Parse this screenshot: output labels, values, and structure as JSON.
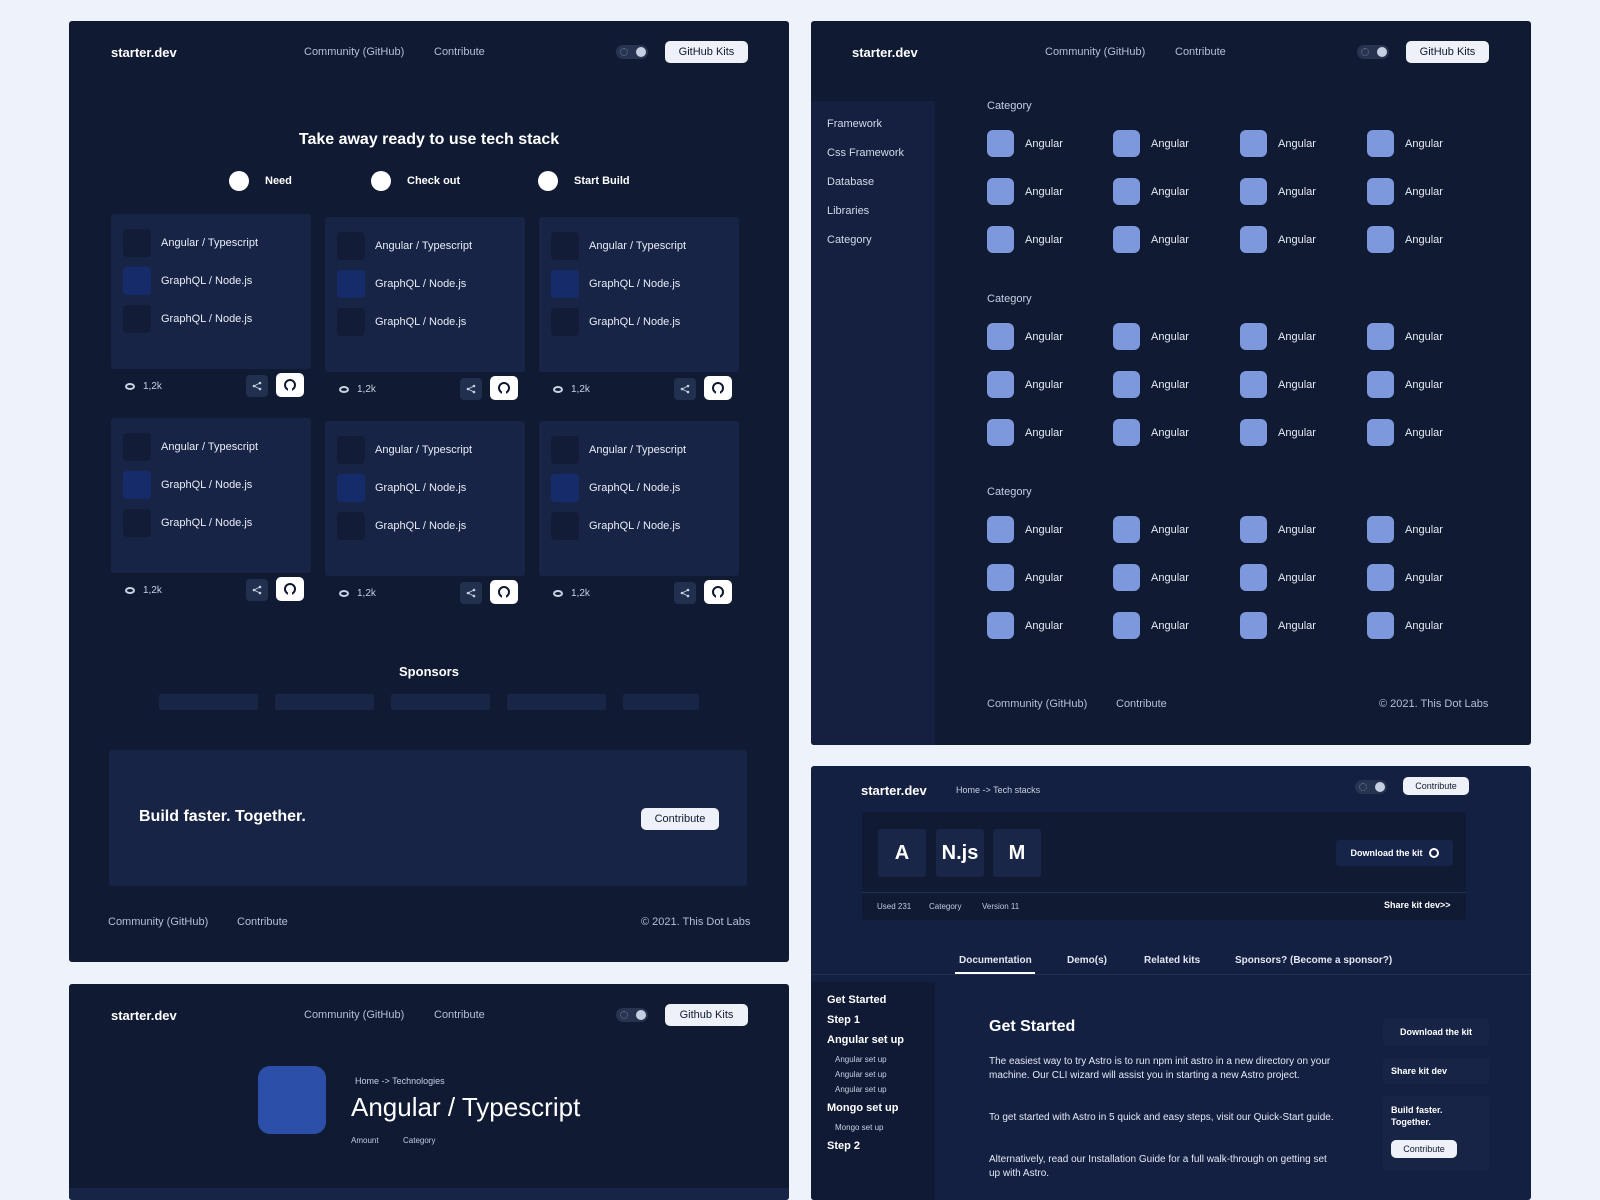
{
  "brand": "starter.dev",
  "nav": {
    "community": "Community (GitHub)",
    "contribute": "Contribute",
    "github_kits": "GitHub Kits",
    "github_kits_alt": "Github Kits"
  },
  "home": {
    "hero_title": "Take away ready to use tech stack",
    "steps": [
      "Need",
      "Check out",
      "Start Build"
    ],
    "cards": [
      {
        "rows": [
          "Angular / Typescript",
          "GraphQL / Node.js",
          "GraphQL / Node.js"
        ],
        "views": "1,2k"
      },
      {
        "rows": [
          "Angular / Typescript",
          "GraphQL / Node.js",
          "GraphQL / Node.js"
        ],
        "views": "1,2k"
      },
      {
        "rows": [
          "Angular / Typescript",
          "GraphQL / Node.js",
          "GraphQL / Node.js"
        ],
        "views": "1,2k"
      },
      {
        "rows": [
          "Angular / Typescript",
          "GraphQL / Node.js",
          "GraphQL / Node.js"
        ],
        "views": "1,2k"
      },
      {
        "rows": [
          "Angular / Typescript",
          "GraphQL / Node.js",
          "GraphQL / Node.js"
        ],
        "views": "1,2k"
      },
      {
        "rows": [
          "Angular / Typescript",
          "GraphQL / Node.js",
          "GraphQL / Node.js"
        ],
        "views": "1,2k"
      }
    ],
    "sponsors_title": "Sponsors",
    "cta_text": "Build faster. Together.",
    "cta_button": "Contribute"
  },
  "footer": {
    "community": "Community (GitHub)",
    "contribute": "Contribute",
    "copyright": "© 2021. This Dot Labs"
  },
  "catalog": {
    "sidebar": [
      "Framework",
      "Css Framework",
      "Database",
      "Libraries",
      "Category"
    ],
    "sections": [
      {
        "title": "Category",
        "items": [
          "Angular",
          "Angular",
          "Angular",
          "Angular",
          "Angular",
          "Angular",
          "Angular",
          "Angular",
          "Angular",
          "Angular",
          "Angular",
          "Angular"
        ]
      },
      {
        "title": "Category",
        "items": [
          "Angular",
          "Angular",
          "Angular",
          "Angular",
          "Angular",
          "Angular",
          "Angular",
          "Angular",
          "Angular",
          "Angular",
          "Angular",
          "Angular"
        ]
      },
      {
        "title": "Category",
        "items": [
          "Angular",
          "Angular",
          "Angular",
          "Angular",
          "Angular",
          "Angular",
          "Angular",
          "Angular",
          "Angular",
          "Angular",
          "Angular",
          "Angular"
        ]
      }
    ]
  },
  "tech": {
    "breadcrumb": "Home -> Technologies",
    "title": "Angular / Typescript",
    "amount": "Amount",
    "category": "Category"
  },
  "kit": {
    "breadcrumb": "Home -> Tech stacks",
    "contribute": "Contribute",
    "letters": [
      "A",
      "N.js",
      "M"
    ],
    "download": "Download the kit",
    "used": "Used 231",
    "category": "Category",
    "version": "Version 11",
    "share": "Share kit dev>>",
    "tabs": [
      "Documentation",
      "Demo(s)",
      "Related kits",
      "Sponsors? (Become a sponsor?)"
    ],
    "toc": {
      "get_started": "Get Started",
      "step1": "Step 1",
      "angular_setup": "Angular set up",
      "angular_sub": [
        "Angular set up",
        "Angular set up",
        "Angular set up"
      ],
      "mongo_setup": "Mongo set up",
      "mongo_sub": "Mongo set up",
      "step2": "Step 2"
    },
    "doc_title": "Get Started",
    "paragraphs": [
      "The easiest way to try Astro is to run npm init astro in a new directory on your machine. Our CLI wizard will assist you in starting a new Astro project.",
      "To get started with Astro in 5 quick and easy steps, visit our Quick-Start guide.",
      "Alternatively, read our Installation Guide for a full walk-through on getting set up with Astro."
    ],
    "side_download": "Download the kit",
    "side_share": "Share kit dev",
    "side_build": "Build faster. Together.",
    "side_contribute": "Contribute"
  }
}
